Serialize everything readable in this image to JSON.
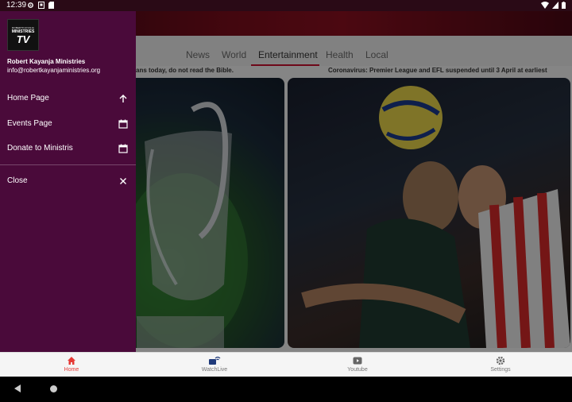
{
  "status_bar": {
    "time": "12:39"
  },
  "tabs": [
    {
      "label": "News"
    },
    {
      "label": "World"
    },
    {
      "label": "Entertainment"
    },
    {
      "label": "Health"
    },
    {
      "label": "Local"
    }
  ],
  "active_tab": "Entertainment",
  "headlines": [
    {
      "text": "ans today, do not read the Bible."
    },
    {
      "text": "Coronavirus: Premier League and EFL suspended until 3 April at earliest"
    }
  ],
  "drawer": {
    "logo": {
      "line1": "ROBERTKAYANJA",
      "line2": "MINISTRIES",
      "line3": "TV"
    },
    "org_name": "Robert Kayanja Ministries",
    "email": "info@robertkayanjaministries.org",
    "menu": [
      {
        "label": "Home Page",
        "icon": "arrow-up-icon"
      },
      {
        "label": "Events Page",
        "icon": "calendar-icon"
      },
      {
        "label": "Donate to  Ministris",
        "icon": "calendar-icon"
      },
      {
        "label": "Close",
        "icon": "close-icon"
      }
    ]
  },
  "bottom_nav": [
    {
      "label": "Home",
      "icon": "home-icon",
      "active": true
    },
    {
      "label": "WatchLive",
      "icon": "live-icon",
      "active": false
    },
    {
      "label": "Youtube",
      "icon": "youtube-icon",
      "active": false
    },
    {
      "label": "Settings",
      "icon": "gear-icon",
      "active": false
    }
  ],
  "colors": {
    "drawer_bg": "#4a0a3a",
    "accent": "#e53935",
    "tab_indicator": "#c8102e"
  }
}
